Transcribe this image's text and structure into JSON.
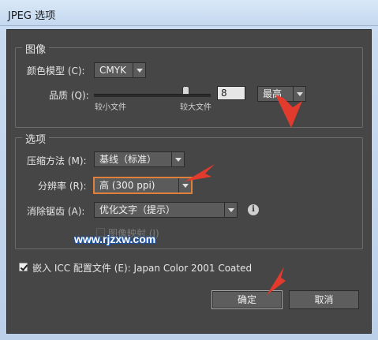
{
  "window": {
    "title": "JPEG 选项"
  },
  "image_group": {
    "legend": "图像",
    "color_model_label": "颜色模型 (C):",
    "color_model_value": "CMYK",
    "quality_label": "品质 (Q):",
    "quality_value": "8",
    "quality_level": 0.8,
    "quality_preset": "最高",
    "smaller_file_label": "较小文件",
    "larger_file_label": "较大文件"
  },
  "options_group": {
    "legend": "选项",
    "compression_label": "压缩方法 (M):",
    "compression_value": "基线（标准）",
    "resolution_label": "分辨率 (R):",
    "resolution_value": "高 (300 ppi)",
    "antialias_label": "消除锯齿 (A):",
    "antialias_value": "优化文字（提示）",
    "imagemap_label": "图像映射 (I)"
  },
  "icc": {
    "label": "嵌入 ICC 配置文件 (E): Japan Color 2001 Coated",
    "checked": true
  },
  "buttons": {
    "ok": "确定",
    "cancel": "取消"
  },
  "watermark": {
    "text": "www.rjzxw.com"
  },
  "colors": {
    "dialog_bg": "#464646",
    "accent": "#e0803a",
    "arrow": "#e23b2e"
  }
}
